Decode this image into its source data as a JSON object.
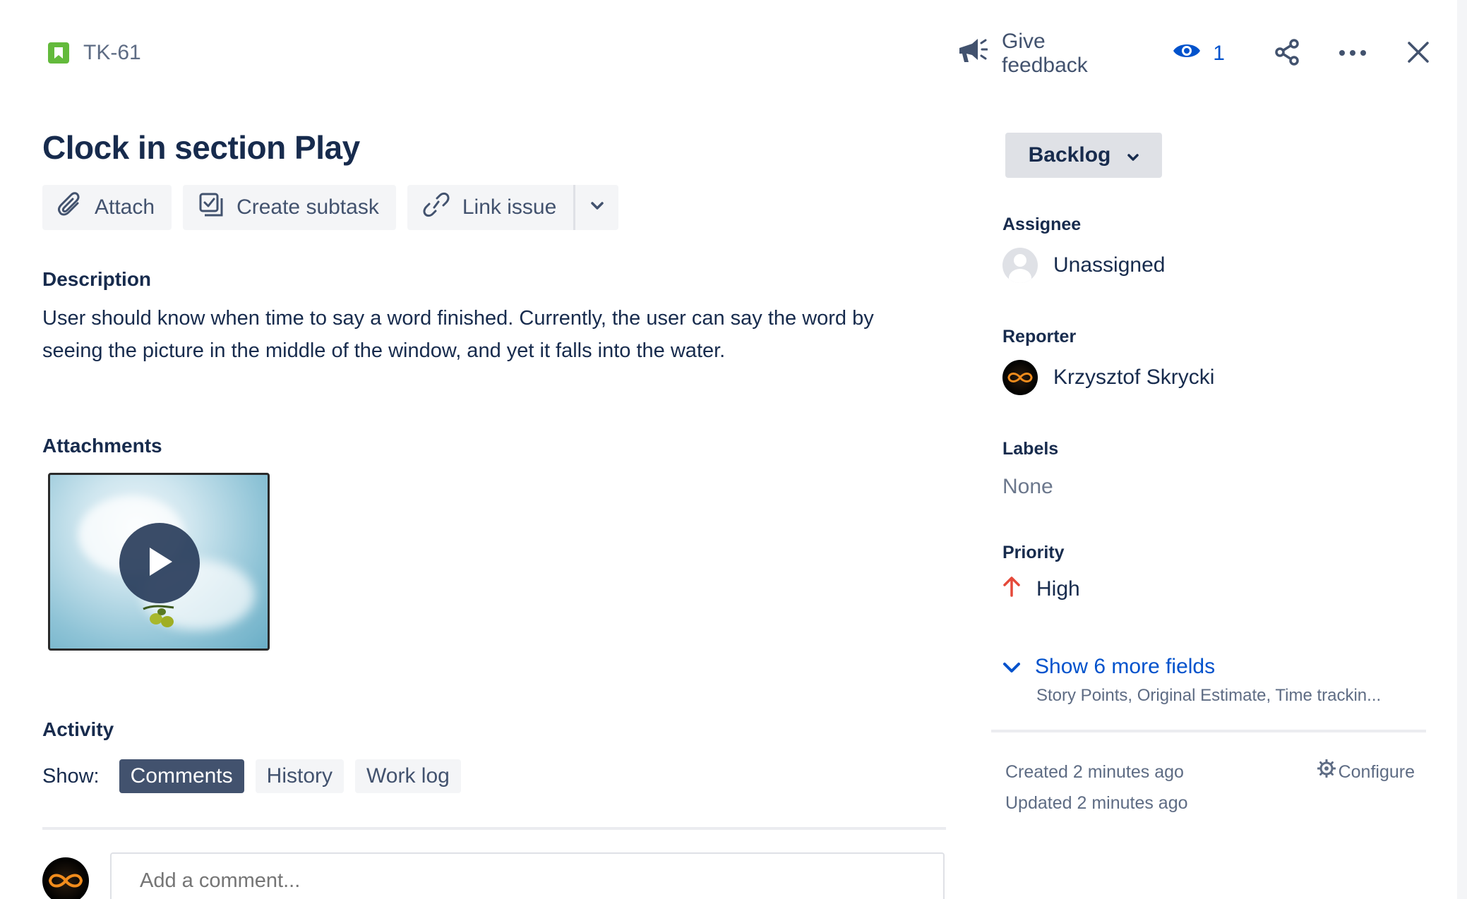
{
  "header": {
    "issue_key": "TK-61",
    "feedback_label": "Give feedback",
    "watch_count": "1",
    "icons": [
      "story-icon",
      "megaphone-icon",
      "eye-icon",
      "share-icon",
      "more-icon",
      "close-icon"
    ]
  },
  "issue": {
    "title": "Clock in section Play"
  },
  "toolbar": {
    "attach_label": "Attach",
    "subtask_label": "Create subtask",
    "link_label": "Link issue"
  },
  "description": {
    "heading": "Description",
    "text": "User should know when time to say a word finished. Currently, the user can say the word by seeing the picture in the middle of the window, and yet it falls into the water."
  },
  "attachments": {
    "heading": "Attachments"
  },
  "activity": {
    "heading": "Activity",
    "show_label": "Show:",
    "tabs": [
      "Comments",
      "History",
      "Work log"
    ],
    "active_tab": "Comments",
    "comment_placeholder": "Add a comment..."
  },
  "sidebar": {
    "status": "Backlog",
    "assignee": {
      "label": "Assignee",
      "value": "Unassigned"
    },
    "reporter": {
      "label": "Reporter",
      "value": "Krzysztof Skrycki"
    },
    "labels": {
      "label": "Labels",
      "value": "None"
    },
    "priority": {
      "label": "Priority",
      "value": "High"
    },
    "more_fields": {
      "link": "Show 6 more fields",
      "sub": "Story Points, Original Estimate, Time trackin..."
    },
    "created": "Created 2 minutes ago",
    "updated": "Updated 2 minutes ago",
    "configure": "Configure"
  },
  "colors": {
    "accent": "#0052cc",
    "story": "#63ba3c",
    "priority_high": "#e5493a",
    "active_tab_bg": "#42526e"
  }
}
